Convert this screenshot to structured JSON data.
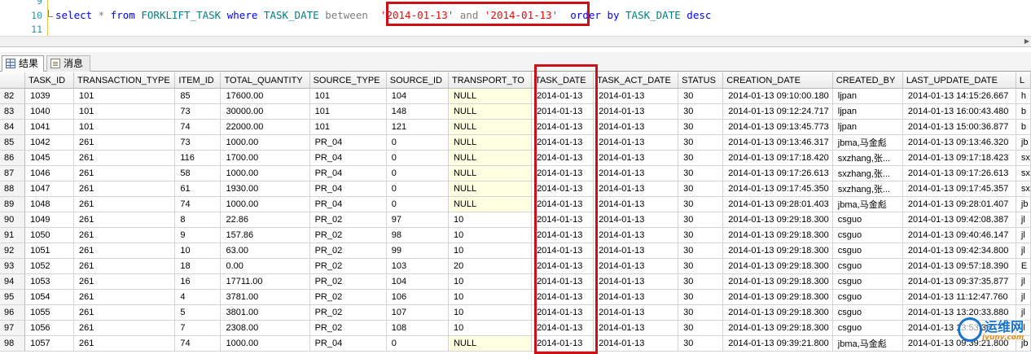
{
  "editor": {
    "line_numbers": [
      "9",
      "10",
      "11"
    ],
    "sql": {
      "kw_select": "select",
      "star": " * ",
      "kw_from": "from",
      "table": "FORKLIFT_TASK",
      "kw_where": "where",
      "column": "TASK_DATE",
      "kw_between": "between",
      "date_from": "'2014-01-13'",
      "kw_and": "and",
      "date_to": "'2014-01-13'",
      "kw_order": "order",
      "kw_by": "by",
      "order_col": "TASK_DATE",
      "kw_desc": "desc"
    }
  },
  "tabs": {
    "results": "结果",
    "messages": "消息"
  },
  "grid": {
    "columns": [
      "",
      "TASK_ID",
      "TRANSACTION_TYPE",
      "ITEM_ID",
      "TOTAL_QUANTITY",
      "SOURCE_TYPE",
      "SOURCE_ID",
      "TRANSPORT_TO",
      "TASK_DATE",
      "TASK_ACT_DATE",
      "STATUS",
      "CREATION_DATE",
      "CREATED_BY",
      "LAST_UPDATE_DATE",
      "L"
    ],
    "rows": [
      [
        "82",
        "1039",
        "101",
        "85",
        "17600.00",
        "101",
        "104",
        "NULL",
        "2014-01-13",
        "2014-01-13",
        "30",
        "2014-01-13 09:10:00.180",
        "ljpan",
        "2014-01-13 14:15:26.667",
        "h"
      ],
      [
        "83",
        "1040",
        "101",
        "73",
        "30000.00",
        "101",
        "148",
        "NULL",
        "2014-01-13",
        "2014-01-13",
        "30",
        "2014-01-13 09:12:24.717",
        "ljpan",
        "2014-01-13 16:00:43.480",
        "b"
      ],
      [
        "84",
        "1041",
        "101",
        "74",
        "22000.00",
        "101",
        "121",
        "NULL",
        "2014-01-13",
        "2014-01-13",
        "30",
        "2014-01-13 09:13:45.773",
        "ljpan",
        "2014-01-13 15:00:36.877",
        "b"
      ],
      [
        "85",
        "1042",
        "261",
        "73",
        "1000.00",
        "PR_04",
        "0",
        "NULL",
        "2014-01-13",
        "2014-01-13",
        "30",
        "2014-01-13 09:13:46.317",
        "jbma,马金彪",
        "2014-01-13 09:13:46.320",
        "jb"
      ],
      [
        "86",
        "1045",
        "261",
        "116",
        "1700.00",
        "PR_04",
        "0",
        "NULL",
        "2014-01-13",
        "2014-01-13",
        "30",
        "2014-01-13 09:17:18.420",
        "sxzhang,张...",
        "2014-01-13 09:17:18.423",
        "sx"
      ],
      [
        "87",
        "1046",
        "261",
        "58",
        "1000.00",
        "PR_04",
        "0",
        "NULL",
        "2014-01-13",
        "2014-01-13",
        "30",
        "2014-01-13 09:17:26.613",
        "sxzhang,张...",
        "2014-01-13 09:17:26.613",
        "sx"
      ],
      [
        "88",
        "1047",
        "261",
        "61",
        "1930.00",
        "PR_04",
        "0",
        "NULL",
        "2014-01-13",
        "2014-01-13",
        "30",
        "2014-01-13 09:17:45.350",
        "sxzhang,张...",
        "2014-01-13 09:17:45.357",
        "sx"
      ],
      [
        "89",
        "1048",
        "261",
        "74",
        "1000.00",
        "PR_04",
        "0",
        "NULL",
        "2014-01-13",
        "2014-01-13",
        "30",
        "2014-01-13 09:28:01.403",
        "jbma,马金彪",
        "2014-01-13 09:28:01.407",
        "jb"
      ],
      [
        "90",
        "1049",
        "261",
        "8",
        "22.86",
        "PR_02",
        "97",
        "10",
        "2014-01-13",
        "2014-01-13",
        "30",
        "2014-01-13 09:29:18.300",
        "csguo",
        "2014-01-13 09:42:08.387",
        "jl"
      ],
      [
        "91",
        "1050",
        "261",
        "9",
        "157.86",
        "PR_02",
        "98",
        "10",
        "2014-01-13",
        "2014-01-13",
        "30",
        "2014-01-13 09:29:18.300",
        "csguo",
        "2014-01-13 09:40:46.147",
        "jl"
      ],
      [
        "92",
        "1051",
        "261",
        "10",
        "63.00",
        "PR_02",
        "99",
        "10",
        "2014-01-13",
        "2014-01-13",
        "30",
        "2014-01-13 09:29:18.300",
        "csguo",
        "2014-01-13 09:42:34.800",
        "jl"
      ],
      [
        "93",
        "1052",
        "261",
        "18",
        "0.00",
        "PR_02",
        "103",
        "20",
        "2014-01-13",
        "2014-01-13",
        "30",
        "2014-01-13 09:29:18.300",
        "csguo",
        "2014-01-13 09:57:18.390",
        "E"
      ],
      [
        "94",
        "1053",
        "261",
        "16",
        "17711.00",
        "PR_02",
        "104",
        "10",
        "2014-01-13",
        "2014-01-13",
        "30",
        "2014-01-13 09:29:18.300",
        "csguo",
        "2014-01-13 09:37:35.877",
        "jl"
      ],
      [
        "95",
        "1054",
        "261",
        "4",
        "3781.00",
        "PR_02",
        "106",
        "10",
        "2014-01-13",
        "2014-01-13",
        "30",
        "2014-01-13 09:29:18.300",
        "csguo",
        "2014-01-13 11:12:47.760",
        "jl"
      ],
      [
        "96",
        "1055",
        "261",
        "5",
        "3801.00",
        "PR_02",
        "107",
        "10",
        "2014-01-13",
        "2014-01-13",
        "30",
        "2014-01-13 09:29:18.300",
        "csguo",
        "2014-01-13 13:20:33.880",
        "jl"
      ],
      [
        "97",
        "1056",
        "261",
        "7",
        "2308.00",
        "PR_02",
        "108",
        "10",
        "2014-01-13",
        "2014-01-13",
        "30",
        "2014-01-13 09:29:18.300",
        "csguo",
        "2014-01-13 13:53:38.",
        "jl"
      ],
      [
        "98",
        "1057",
        "261",
        "74",
        "1000.00",
        "PR_04",
        "0",
        "NULL",
        "2014-01-13",
        "2014-01-13",
        "30",
        "2014-01-13 09:39:21.800",
        "jbma,马金彪",
        "2014-01-13 09:39:21.800",
        "jb"
      ]
    ]
  },
  "watermark": {
    "title": "运维网",
    "subtitle": "iyunv.com"
  }
}
